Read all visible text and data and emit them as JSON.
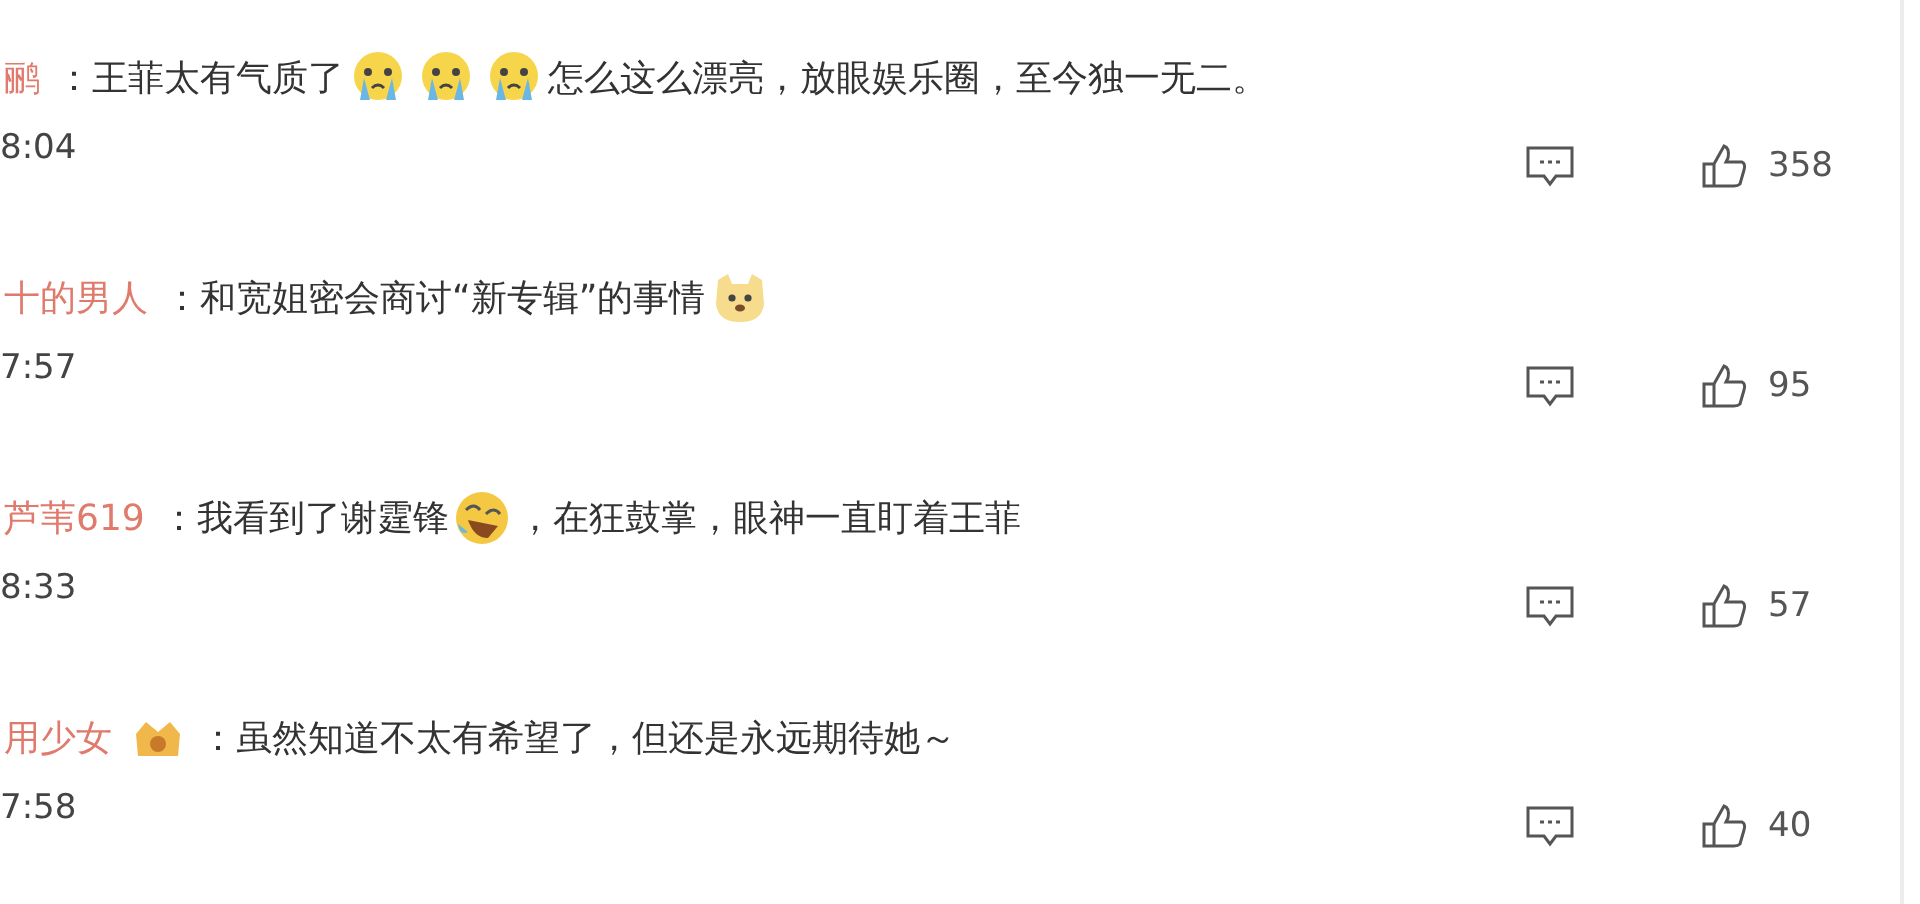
{
  "comments": [
    {
      "user": "鹂",
      "badge": false,
      "segments": [
        {
          "kind": "text",
          "text": "：王菲太有气质了"
        },
        {
          "kind": "cry"
        },
        {
          "kind": "cry"
        },
        {
          "kind": "cry"
        },
        {
          "kind": "text",
          "text": "怎么这么漂亮，放眼娱乐圈，至今独一无二。"
        }
      ],
      "time": "8:04",
      "likes": "358"
    },
    {
      "user": "十的男人",
      "badge": false,
      "segments": [
        {
          "kind": "text",
          "text": "：和宽姐密会商讨“新专辑”的事情"
        },
        {
          "kind": "dog"
        }
      ],
      "time": "7:57",
      "likes": "95"
    },
    {
      "user": "芦苇619",
      "badge": false,
      "segments": [
        {
          "kind": "text",
          "text": "：我看到了谢霆锋"
        },
        {
          "kind": "laugh"
        },
        {
          "kind": "text",
          "text": "，在狂鼓掌，眼神一直盯着王菲"
        }
      ],
      "time": "8:33",
      "likes": "57"
    },
    {
      "user": "用少女",
      "badge": true,
      "segments": [
        {
          "kind": "text",
          "text": "：虽然知道不太有希望了，但还是永远期待她～"
        }
      ],
      "time": "7:58",
      "likes": "40"
    }
  ]
}
